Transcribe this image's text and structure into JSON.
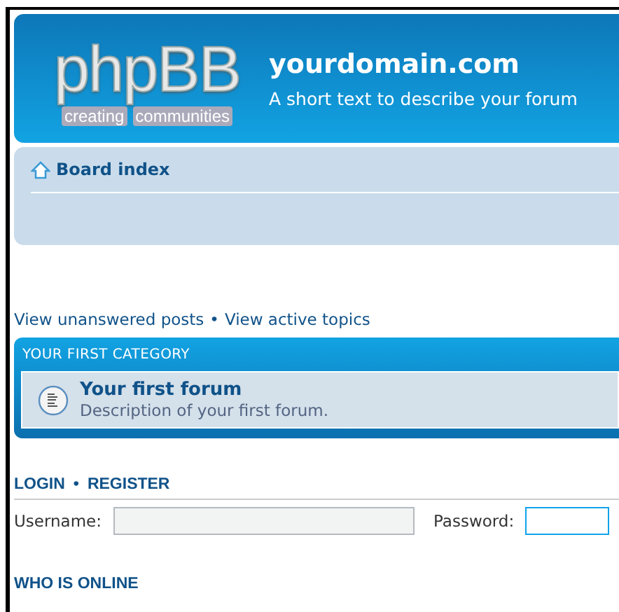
{
  "header": {
    "logo": {
      "wordmark": "phpBB",
      "tagline_left": "creating",
      "tagline_right": "communities"
    },
    "site_title": "yourdomain.com",
    "site_description": "A short text to describe your forum"
  },
  "navbar": {
    "breadcrumb": "Board index"
  },
  "quick_links": [
    {
      "label": "View unanswered posts"
    },
    {
      "label": "View active topics"
    }
  ],
  "quick_links_separator": "•",
  "categories": [
    {
      "title": "YOUR FIRST CATEGORY",
      "forums": [
        {
          "name": "Your first forum",
          "description": "Description of your first forum."
        }
      ]
    }
  ],
  "login": {
    "heading_links": [
      {
        "label": "LOGIN"
      },
      {
        "label": "REGISTER"
      }
    ],
    "separator": "•",
    "fields": [
      {
        "label": "Username:",
        "focused": false
      },
      {
        "label": "Password:",
        "focused": true
      }
    ]
  },
  "who_is_online": {
    "heading": "WHO IS ONLINE"
  }
}
